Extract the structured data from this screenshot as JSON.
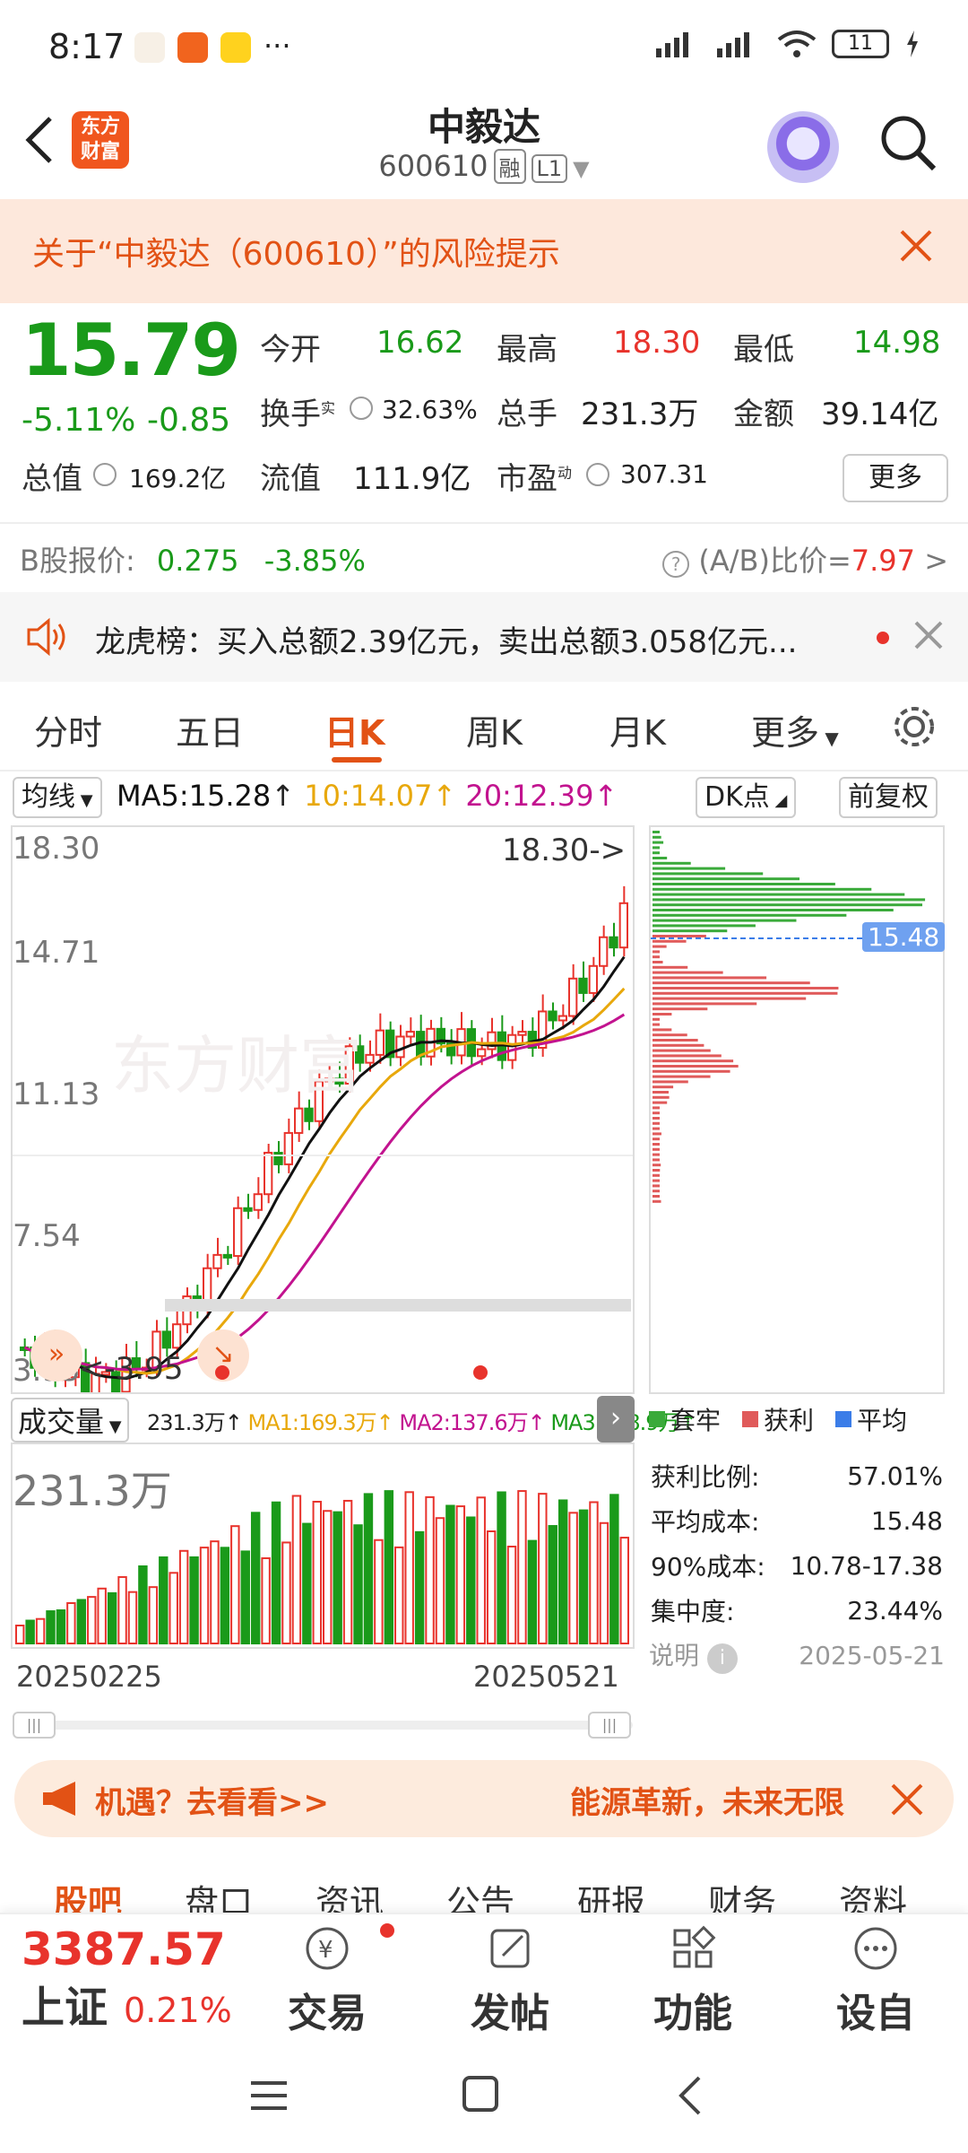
{
  "status": {
    "time": "8:17",
    "battery": "11"
  },
  "header": {
    "title": "中毅达",
    "code": "600610",
    "tag_rong": "融",
    "tag_level": "L1",
    "logo_line1": "东方",
    "logo_line2": "财富"
  },
  "risk": {
    "text": "关于“中毅达（600610）”的风险提示"
  },
  "quote": {
    "price": "15.79",
    "pct": "-5.11%",
    "chg": "-0.85",
    "open_label": "今开",
    "open": "16.62",
    "high_label": "最高",
    "high": "18.30",
    "low_label": "最低",
    "low": "14.98",
    "turnover_label": "换手",
    "turnover_sup": "实",
    "turnover": "32.63%",
    "vol_label": "总手",
    "vol": "231.3万",
    "amount_label": "金额",
    "amount": "39.14亿",
    "mktcap_label": "总值",
    "mktcap": "169.2亿",
    "float_label": "流值",
    "float": "111.9亿",
    "pe_label": "市盈",
    "pe_sup": "动",
    "pe": "307.31",
    "more": "更多"
  },
  "bshare": {
    "label": "B股报价:",
    "price": "0.275",
    "pct": "-3.85%",
    "ratio_label": "(A/B)比价=",
    "ratio": "7.97"
  },
  "dragon": {
    "text": "龙虎榜：买入总额2.39亿元，卖出总额3.058亿元..."
  },
  "tabs": [
    "分时",
    "五日",
    "日K",
    "周K",
    "月K",
    "更多"
  ],
  "ma": {
    "type": "均线",
    "ma5": "MA5:15.28",
    "ma10": "10:14.07",
    "ma20": "20:12.39",
    "dk": "DK点",
    "fq": "前复权"
  },
  "kline": {
    "y_labels": [
      "18.30",
      "14.71",
      "11.13",
      "7.54",
      "3.95"
    ],
    "hi_tag": "18.30->",
    "lo_tag": "<-3.95",
    "avg_tag": "15.48"
  },
  "volume": {
    "label": "成交量",
    "v": "231.3万",
    "ma1": "MA1:169.3万",
    "ma2": "MA2:137.6万",
    "ma3": "MA3:128.9万",
    "big": "231.3万",
    "d1": "20250225",
    "d2": "20250521"
  },
  "chips": {
    "legend": [
      "套牢",
      "获利",
      "平均"
    ],
    "stats": [
      {
        "k": "获利比例:",
        "v": "57.01%"
      },
      {
        "k": "平均成本:",
        "v": "15.48"
      },
      {
        "k": "90%成本:",
        "v": "10.78-17.38"
      },
      {
        "k": "集中度:",
        "v": "23.44%"
      }
    ],
    "note": "说明",
    "date": "2025-05-21"
  },
  "ad": {
    "t1": "机遇？去看看>>",
    "t2": "能源革新，未来无限"
  },
  "btabs": [
    "股吧",
    "盘口",
    "资讯",
    "公告",
    "研报",
    "财务",
    "资料"
  ],
  "bottom": {
    "index_val": "3387.57",
    "index_name": "上证",
    "index_pct": "0.21%",
    "items": [
      "交易",
      "发帖",
      "功能",
      "设自选"
    ]
  },
  "colors": {
    "up": "#e8332c",
    "down": "#1a9a1a",
    "accent": "#e25215"
  }
}
